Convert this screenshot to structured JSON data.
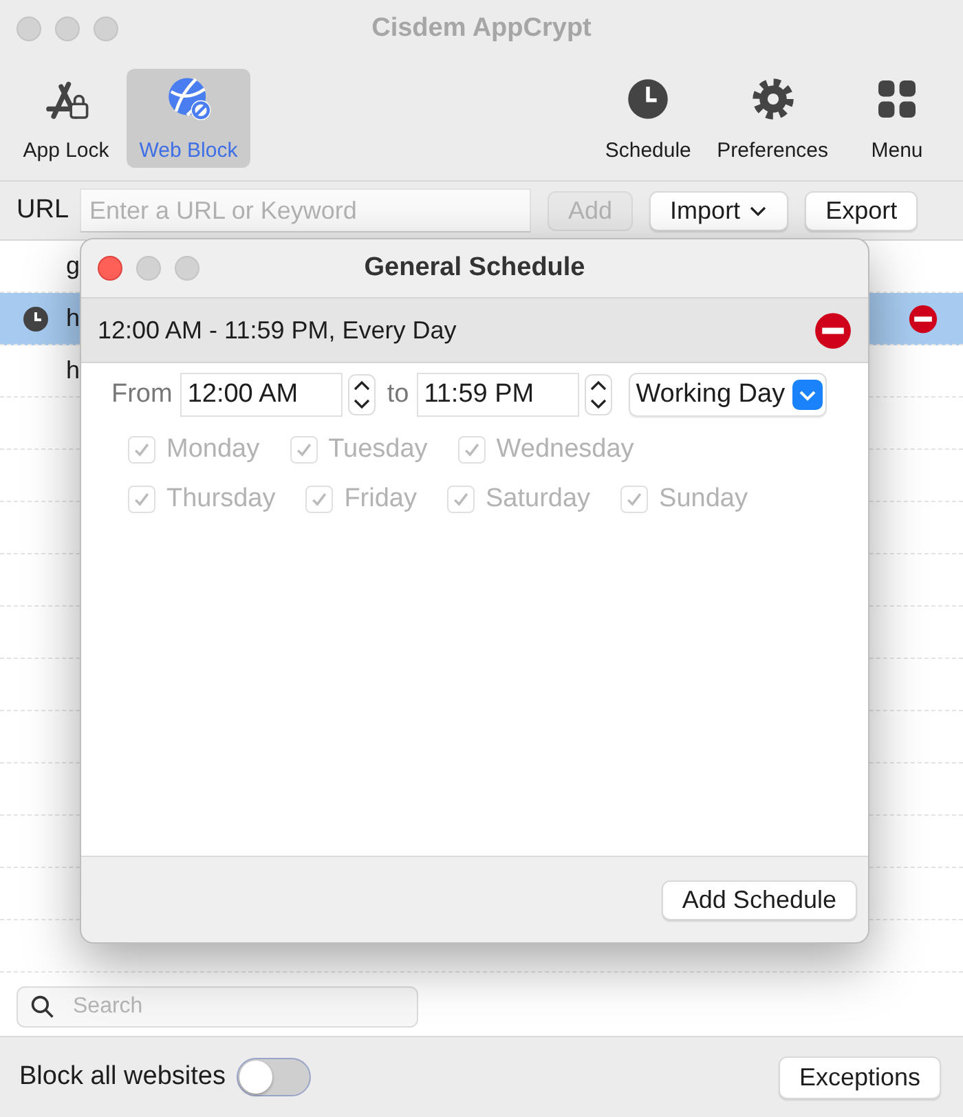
{
  "window": {
    "title": "Cisdem AppCrypt"
  },
  "modes": [
    {
      "label": "App Lock",
      "selected": false
    },
    {
      "label": "Web Block",
      "selected": true
    }
  ],
  "toolbar_buttons": [
    {
      "label": "Schedule",
      "kind": "clock"
    },
    {
      "label": "Preferences",
      "kind": "gear"
    },
    {
      "label": "Menu",
      "kind": "grid"
    }
  ],
  "url_bar": {
    "label": "URL",
    "placeholder": "Enter a URL or Keyword",
    "add_button": {
      "label": "Add",
      "disabled": true
    },
    "import_button": {
      "label": "Import"
    },
    "export_button": {
      "label": "Export"
    }
  },
  "table": {
    "rows": [
      {
        "text": "g",
        "selected": false,
        "scheduled": false
      },
      {
        "text": "h",
        "selected": true,
        "scheduled": true
      },
      {
        "text": "h",
        "selected": false,
        "scheduled": false
      }
    ]
  },
  "dialog": {
    "title": "General Schedule",
    "schedules": [
      {
        "summary": "12:00 AM - 11:59 PM, Every Day",
        "selected": true
      }
    ],
    "from_label": "From",
    "from": "12:00 AM",
    "to_label": "to",
    "to": "11:59 PM",
    "repeat": "Working Day",
    "day_rows": [
      [
        {
          "label": "Monday",
          "checked": true,
          "disabled": true
        },
        {
          "label": "Tuesday",
          "checked": true,
          "disabled": true
        },
        {
          "label": "Wednesday",
          "checked": true,
          "disabled": true
        }
      ],
      [
        {
          "label": "Thursday",
          "checked": true,
          "disabled": true
        },
        {
          "label": "Friday",
          "checked": true,
          "disabled": true
        },
        {
          "label": "Saturday",
          "checked": true,
          "disabled": true
        },
        {
          "label": "Sunday",
          "checked": true,
          "disabled": true
        }
      ]
    ],
    "add_button": {
      "label": "Add Schedule"
    }
  },
  "search": {
    "placeholder": "Search"
  },
  "footer": {
    "block_all": {
      "label": "Block all websites",
      "on": false
    },
    "exceptions_button": {
      "label": "Exceptions"
    }
  }
}
